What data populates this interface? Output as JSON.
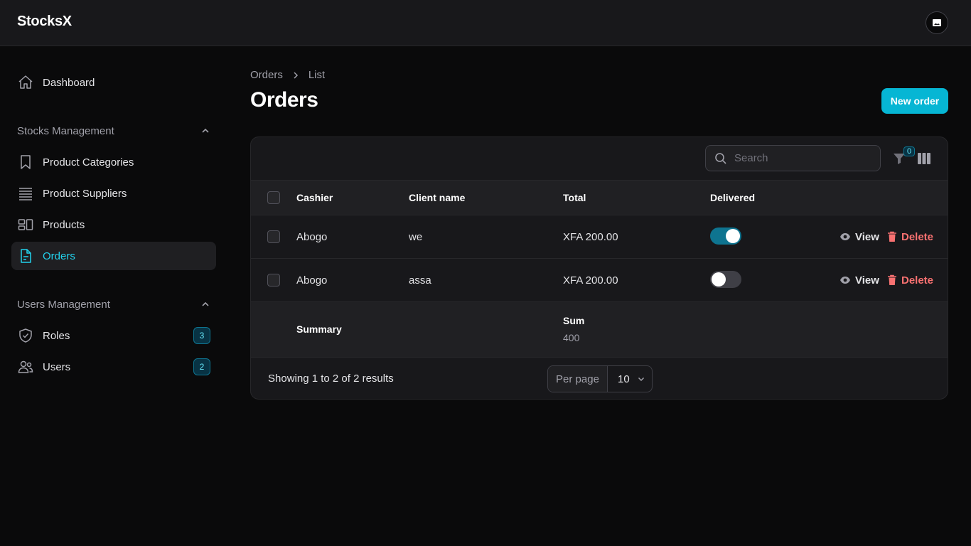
{
  "app": {
    "brand": "StocksX"
  },
  "sidebar": {
    "dashboard": "Dashboard",
    "groups": [
      {
        "title": "Stocks Management",
        "items": [
          {
            "label": "Product Categories"
          },
          {
            "label": "Product Suppliers"
          },
          {
            "label": "Products"
          },
          {
            "label": "Orders",
            "active": true
          }
        ]
      },
      {
        "title": "Users Management",
        "items": [
          {
            "label": "Roles",
            "badge": "3"
          },
          {
            "label": "Users",
            "badge": "2"
          }
        ]
      }
    ]
  },
  "breadcrumb": {
    "parent": "Orders",
    "current": "List"
  },
  "page": {
    "title": "Orders",
    "new_button": "New order"
  },
  "table": {
    "search_placeholder": "Search",
    "filter_count": "0",
    "columns": [
      "Cashier",
      "Client name",
      "Total",
      "Delivered"
    ],
    "rows": [
      {
        "cashier": "Abogo",
        "client": "we",
        "total": "XFA 200.00",
        "delivered": true
      },
      {
        "cashier": "Abogo",
        "client": "assa",
        "total": "XFA 200.00",
        "delivered": false
      }
    ],
    "actions": {
      "view": "View",
      "delete": "Delete"
    },
    "summary": {
      "label": "Summary",
      "sum_label": "Sum",
      "sum_value": "400"
    },
    "footer": {
      "showing": "Showing 1 to 2 of 2 results",
      "per_page_label": "Per page",
      "per_page_value": "10"
    }
  },
  "colors": {
    "accent": "#06b6d4",
    "danger": "#f87171",
    "background": "#0a0a0b",
    "surface": "#18181b"
  }
}
